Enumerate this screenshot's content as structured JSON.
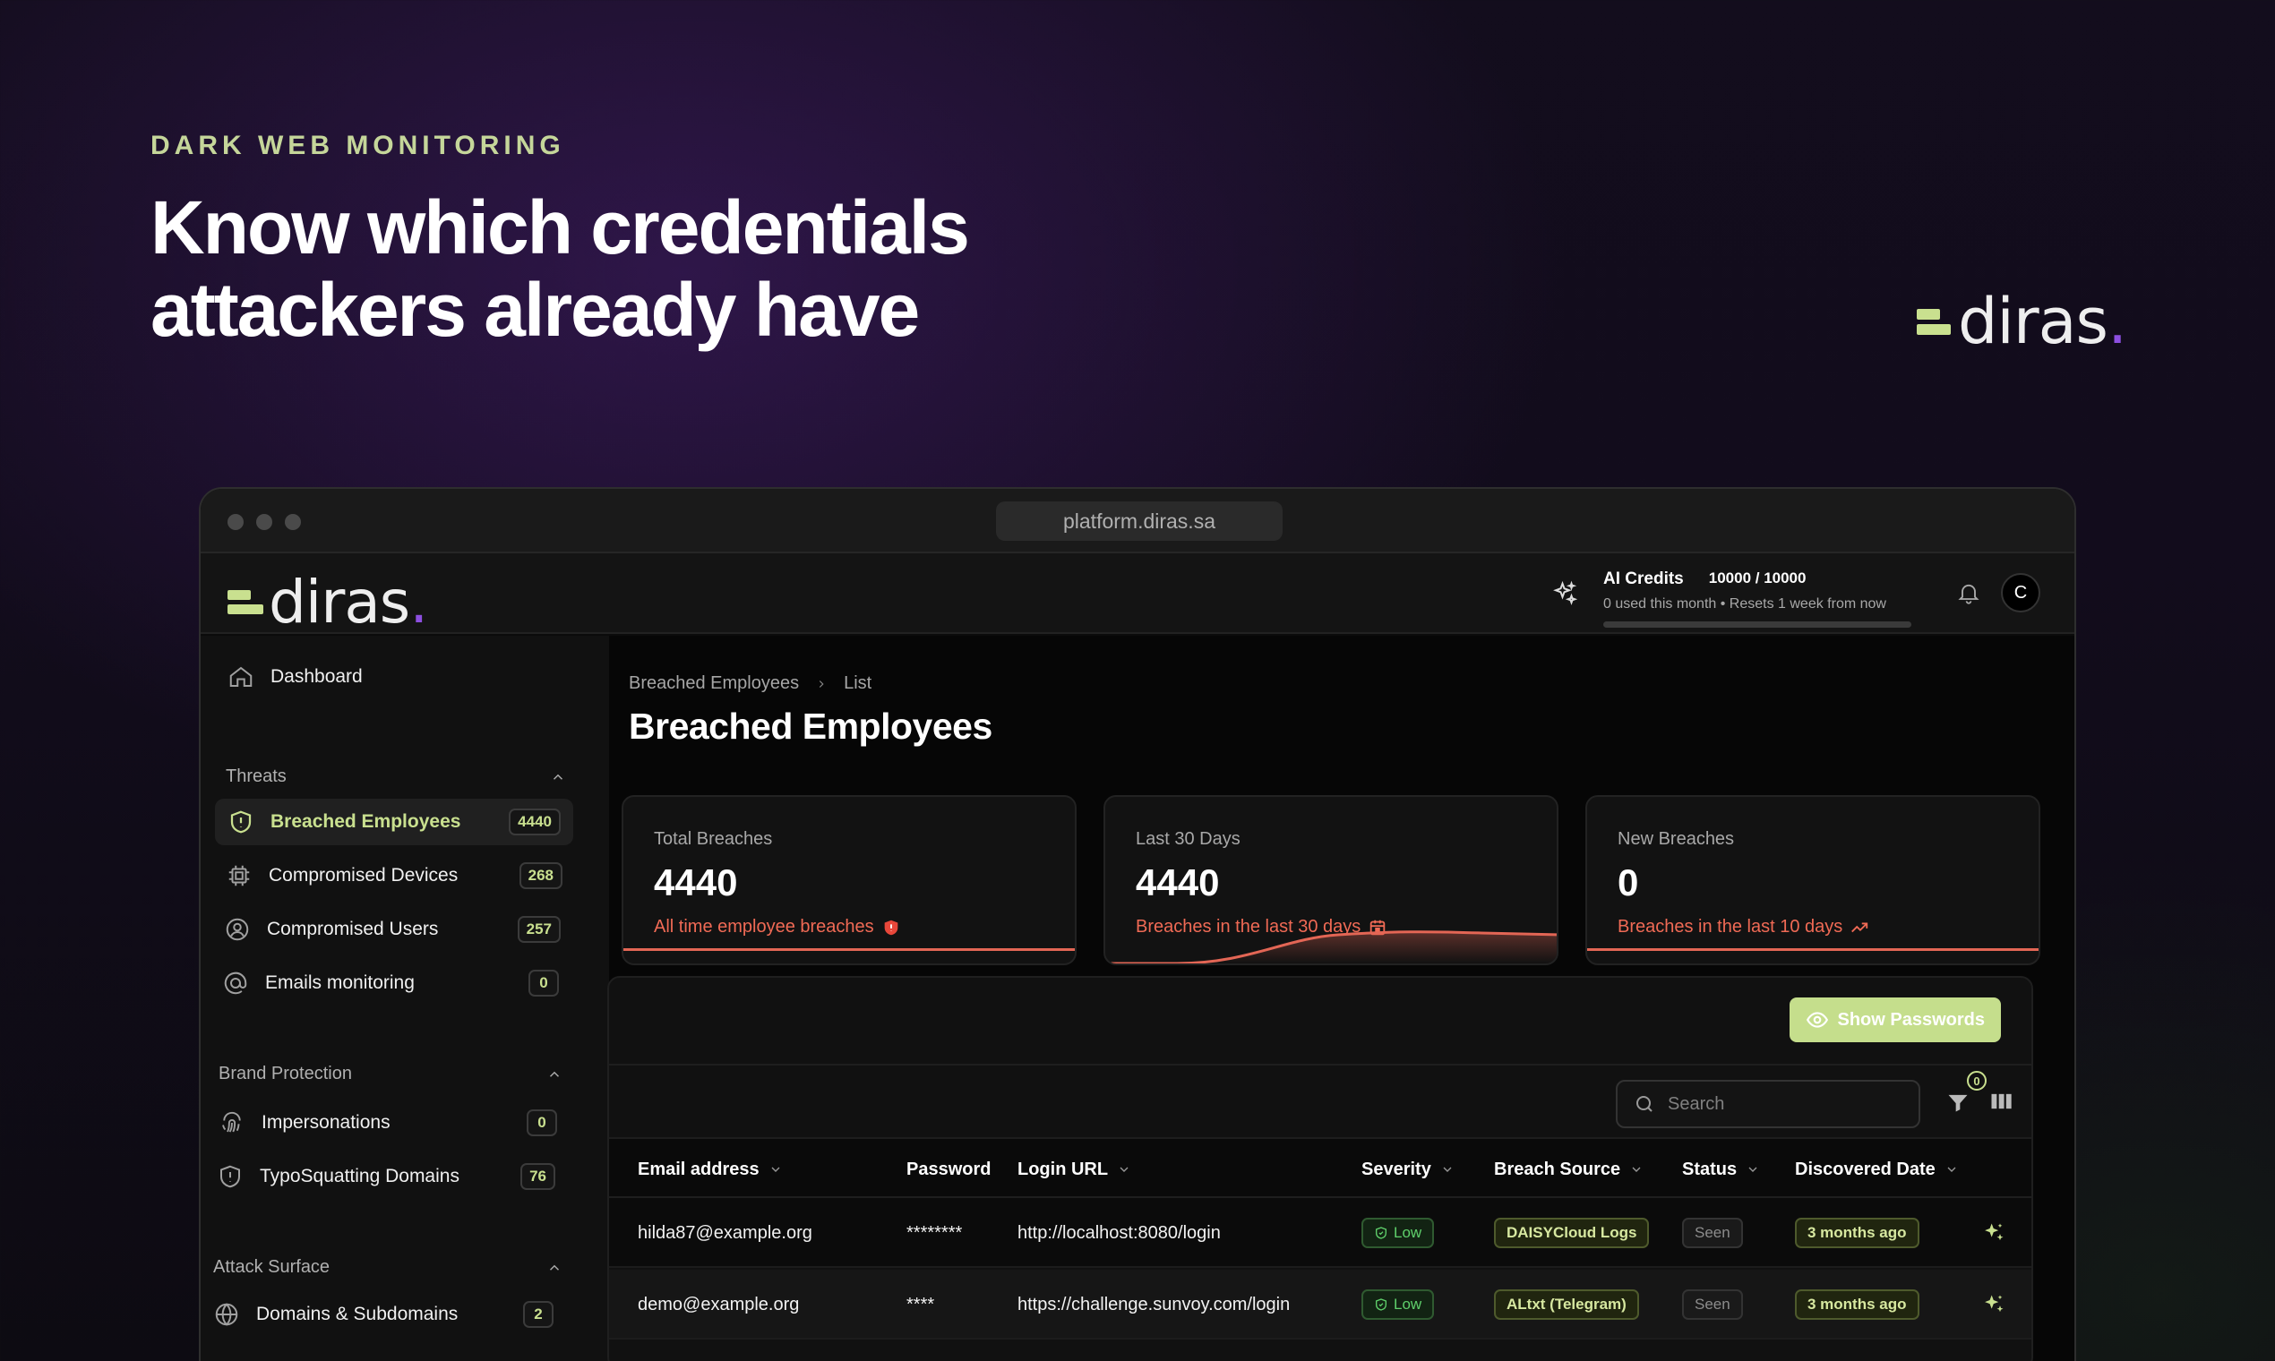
{
  "hero": {
    "eyebrow": "DARK WEB MONITORING",
    "headline_line1": "Know which credentials",
    "headline_line2": "attackers already have",
    "brand": "diras",
    "brand_dot": "."
  },
  "browser": {
    "url": "platform.diras.sa"
  },
  "appbar": {
    "brand": "diras",
    "brand_dot": ".",
    "ai_credits_label": "AI Credits",
    "ai_credits_value": "10000 / 10000",
    "ai_credits_note": "0 used this month • Resets 1 week from now",
    "ai_credits_used_fraction": 0,
    "avatar_initial": "C"
  },
  "sidebar": {
    "dashboard": "Dashboard",
    "sections": [
      {
        "title": "Threats",
        "items": [
          {
            "label": "Breached Employees",
            "count": "4440",
            "icon": "shield-icon",
            "active": true
          },
          {
            "label": "Compromised Devices",
            "count": "268",
            "icon": "chip-icon"
          },
          {
            "label": "Compromised Users",
            "count": "257",
            "icon": "user-circle-icon"
          },
          {
            "label": "Emails monitoring",
            "count": "0",
            "icon": "at-sign-icon"
          }
        ]
      },
      {
        "title": "Brand Protection",
        "items": [
          {
            "label": "Impersonations",
            "count": "0",
            "icon": "fingerprint-icon"
          },
          {
            "label": "TypoSquatting Domains",
            "count": "76",
            "icon": "shield-alert-icon"
          }
        ]
      },
      {
        "title": "Attack Surface",
        "items": [
          {
            "label": "Domains & Subdomains",
            "count": "2",
            "icon": "globe-icon"
          }
        ]
      }
    ]
  },
  "main": {
    "breadcrumb": [
      "Breached Employees",
      "List"
    ],
    "title": "Breached Employees",
    "stats": [
      {
        "label": "Total Breaches",
        "value": "4440",
        "sub": "All time employee breaches",
        "icon": "shield-alert-icon"
      },
      {
        "label": "Last 30 Days",
        "value": "4440",
        "sub": "Breaches in the last 30 days",
        "icon": "calendar-icon"
      },
      {
        "label": "New Breaches",
        "value": "0",
        "sub": "Breaches in the last 10 days",
        "icon": "trend-up-icon"
      }
    ],
    "show_passwords": "Show Passwords",
    "search_placeholder": "Search",
    "filter_count": "0",
    "columns": [
      "Email address",
      "Password",
      "Login URL",
      "Severity",
      "Breach Source",
      "Status",
      "Discovered Date"
    ],
    "rows": [
      {
        "email": "hilda87@example.org",
        "password": "********",
        "url": "http://localhost:8080/login",
        "severity": "Low",
        "source": "DAISYCloud Logs",
        "status": "Seen",
        "date": "3 months ago"
      },
      {
        "email": "demo@example.org",
        "password": "****",
        "url": "https://challenge.sunvoy.com/login",
        "severity": "Low",
        "source": "ALtxt (Telegram)",
        "status": "Seen",
        "date": "3 months ago"
      }
    ]
  }
}
